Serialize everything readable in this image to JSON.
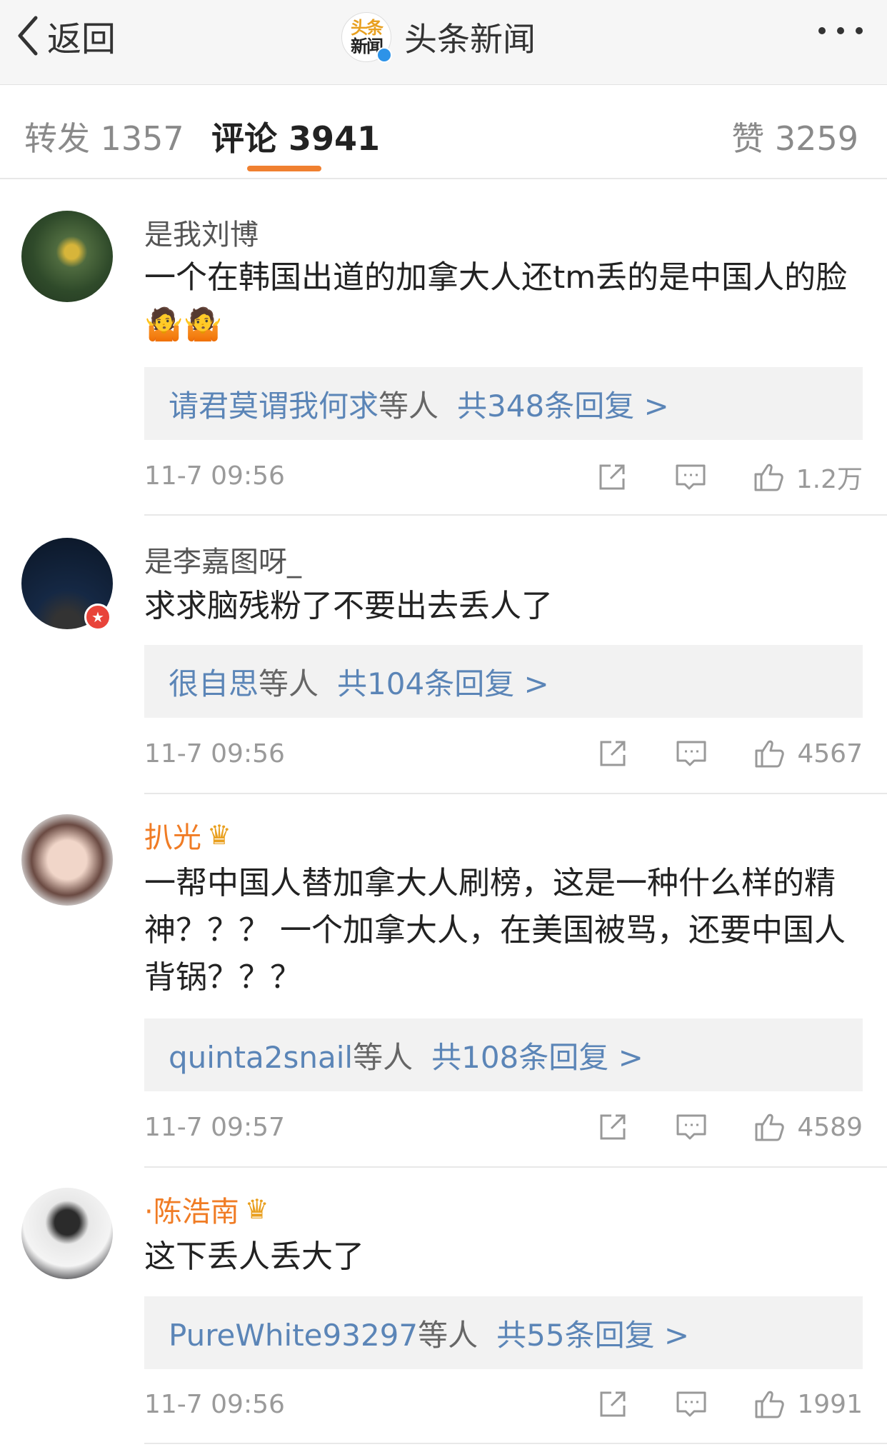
{
  "nav": {
    "back_label": "返回",
    "title": "头条新闻",
    "logo_line1": "头条",
    "logo_line2": "新闻"
  },
  "tabs": [
    {
      "label": "转发 1357"
    },
    {
      "label": "评论 3941"
    },
    {
      "label": "赞 3259"
    }
  ],
  "comments": [
    {
      "username": "是我刘博",
      "text": "一个在韩国出道的加拿大人还tm丢的是中国人的脸🤷🤷",
      "reply_users": "请君莫谓我何求",
      "reply_suffix": "等人",
      "reply_count": "共348条回复 >",
      "time": "11-7 09:56",
      "likes": "1.2万"
    },
    {
      "username": "是李嘉图呀_",
      "text": "求求脑残粉了不要出去丢人了",
      "reply_users": "很自思",
      "reply_suffix": "等人",
      "reply_count": "共104条回复 >",
      "time": "11-7 09:56",
      "likes": "4567"
    },
    {
      "username": "扒光",
      "text": "一帮中国人替加拿大人刷榜，这是一种什么样的精神？？？ 一个加拿大人，在美国被骂，还要中国人背锅？？？",
      "reply_users": "quinta2snail",
      "reply_suffix": "等人",
      "reply_count": "共108条回复 >",
      "time": "11-7 09:57",
      "likes": "4589"
    },
    {
      "username": "·陈浩南",
      "text": "这下丢人丢大了",
      "reply_users": "PureWhite93297",
      "reply_suffix": "等人",
      "reply_count": "共55条回复 >",
      "time": "11-7 09:56",
      "likes": "1991"
    }
  ],
  "colors": {
    "accent": "#f08030",
    "link": "#5b85b7",
    "vip_name": "#f07c25"
  }
}
